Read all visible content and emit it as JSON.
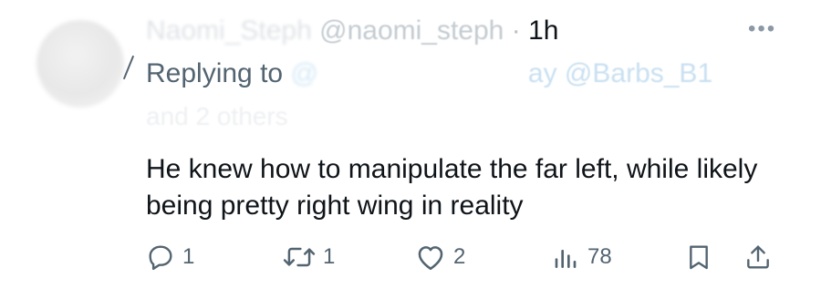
{
  "header": {
    "display_name": "Naomi_Steph",
    "handle": "@naomi_steph",
    "separator": "·",
    "time": "1h",
    "more_icon": "more-horizontal-icon"
  },
  "reply_context": {
    "prefix": "Replying to",
    "mention_hidden": "@",
    "mention_visible": "ay @Barbs_B1",
    "others": "and 2 others"
  },
  "tweet": {
    "text": "He knew how to manipulate the far left, while likely being pretty right wing in reality"
  },
  "actions": {
    "reply": {
      "icon": "reply-icon",
      "count": "1"
    },
    "repost": {
      "icon": "repost-icon",
      "count": "1"
    },
    "like": {
      "icon": "heart-icon",
      "count": "2"
    },
    "views": {
      "icon": "bar-chart-icon",
      "count": "78"
    },
    "bookmark": {
      "icon": "bookmark-icon"
    },
    "share": {
      "icon": "share-icon"
    }
  },
  "colors": {
    "text": "#0f1419",
    "secondary": "#536471",
    "background": "#ffffff"
  }
}
